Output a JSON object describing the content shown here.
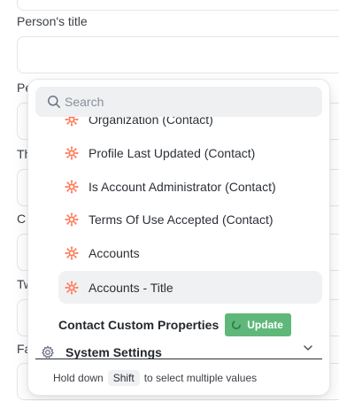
{
  "form": {
    "labels": [
      "Person's title",
      "Pe",
      "Th",
      "C",
      "Tw",
      "Fa"
    ]
  },
  "dropdown": {
    "search_placeholder": "Search",
    "items": [
      {
        "label": "Organization (Contact)",
        "selected": false
      },
      {
        "label": "Profile Last Updated (Contact)",
        "selected": false
      },
      {
        "label": "Is Account Administrator (Contact)",
        "selected": false
      },
      {
        "label": "Terms Of Use Accepted (Contact)",
        "selected": false
      },
      {
        "label": "Accounts",
        "selected": false
      },
      {
        "label": "Accounts - Title",
        "selected": true
      }
    ],
    "item_icon": "hubspot-sprocket-icon",
    "group_label": "Contact Custom Properties",
    "update_label": "Update",
    "system_label": "System Settings",
    "hint": {
      "prefix": "Hold down",
      "key": "Shift",
      "suffix": "to select multiple values"
    }
  },
  "colors": {
    "accent_orange": "#ff7a59",
    "update_green": "#5fb87a",
    "selected_bg": "#f0f1f3"
  }
}
